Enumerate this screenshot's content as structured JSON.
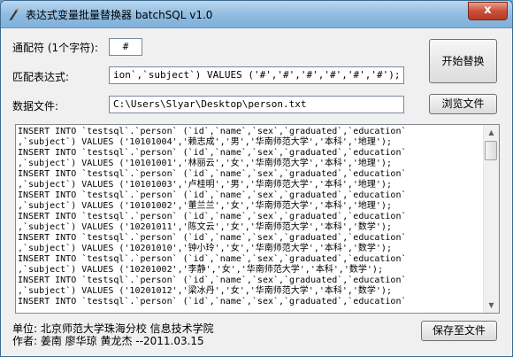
{
  "window": {
    "title": "表达式变量批量替换器 batchSQL v1.0",
    "close_glyph": "x"
  },
  "wildcard": {
    "label": "通配符 (1个字符):",
    "value": "#"
  },
  "pattern": {
    "label": "匹配表达式:",
    "value": "ion`,`subject`) VALUES ('#','#','#','#','#','#');"
  },
  "datafile": {
    "label": "数据文件:",
    "value": "C:\\Users\\Slyar\\Desktop\\person.txt"
  },
  "buttons": {
    "start": "开始替换",
    "browse": "浏览文件",
    "save": "保存至文件"
  },
  "output_lines": [
    "INSERT INTO `testsql`.`person` (`id`,`name`,`sex`,`graduated`,`education`",
    ",`subject`) VALUES ('10101004','赖志成','男','华南师范大学','本科','地理');",
    "INSERT INTO `testsql`.`person` (`id`,`name`,`sex`,`graduated`,`education`",
    ",`subject`) VALUES ('10101001','林丽云','女','华南师范大学','本科','地理');",
    "INSERT INTO `testsql`.`person` (`id`,`name`,`sex`,`graduated`,`education`",
    ",`subject`) VALUES ('10101003','卢桂明','男','华南师范大学','本科','地理');",
    "INSERT INTO `testsql`.`person` (`id`,`name`,`sex`,`graduated`,`education`",
    ",`subject`) VALUES ('10101002','董兰兰','女','华南师范大学','本科','地理');",
    "INSERT INTO `testsql`.`person` (`id`,`name`,`sex`,`graduated`,`education`",
    ",`subject`) VALUES ('10201011','陈文云','女','华南师范大学','本科','数学');",
    "INSERT INTO `testsql`.`person` (`id`,`name`,`sex`,`graduated`,`education`",
    ",`subject`) VALUES ('10201010','钟小玲','女','华南师范大学','本科','数学');",
    "INSERT INTO `testsql`.`person` (`id`,`name`,`sex`,`graduated`,`education`",
    ",`subject`) VALUES ('10201002','李静','女','华南师范大学','本科','数学');",
    "INSERT INTO `testsql`.`person` (`id`,`name`,`sex`,`graduated`,`education`",
    ",`subject`) VALUES ('10201012','梁冰丹','女','华南师范大学','本科','数学');",
    "INSERT INTO `testsql`.`person` (`id`,`name`,`sex`,`graduated`,`education`"
  ],
  "footer": {
    "unit": "单位: 北京师范大学珠海分校 信息技术学院",
    "author": "作者: 姜南 廖华琼 黄龙杰  --2011.03.15"
  }
}
